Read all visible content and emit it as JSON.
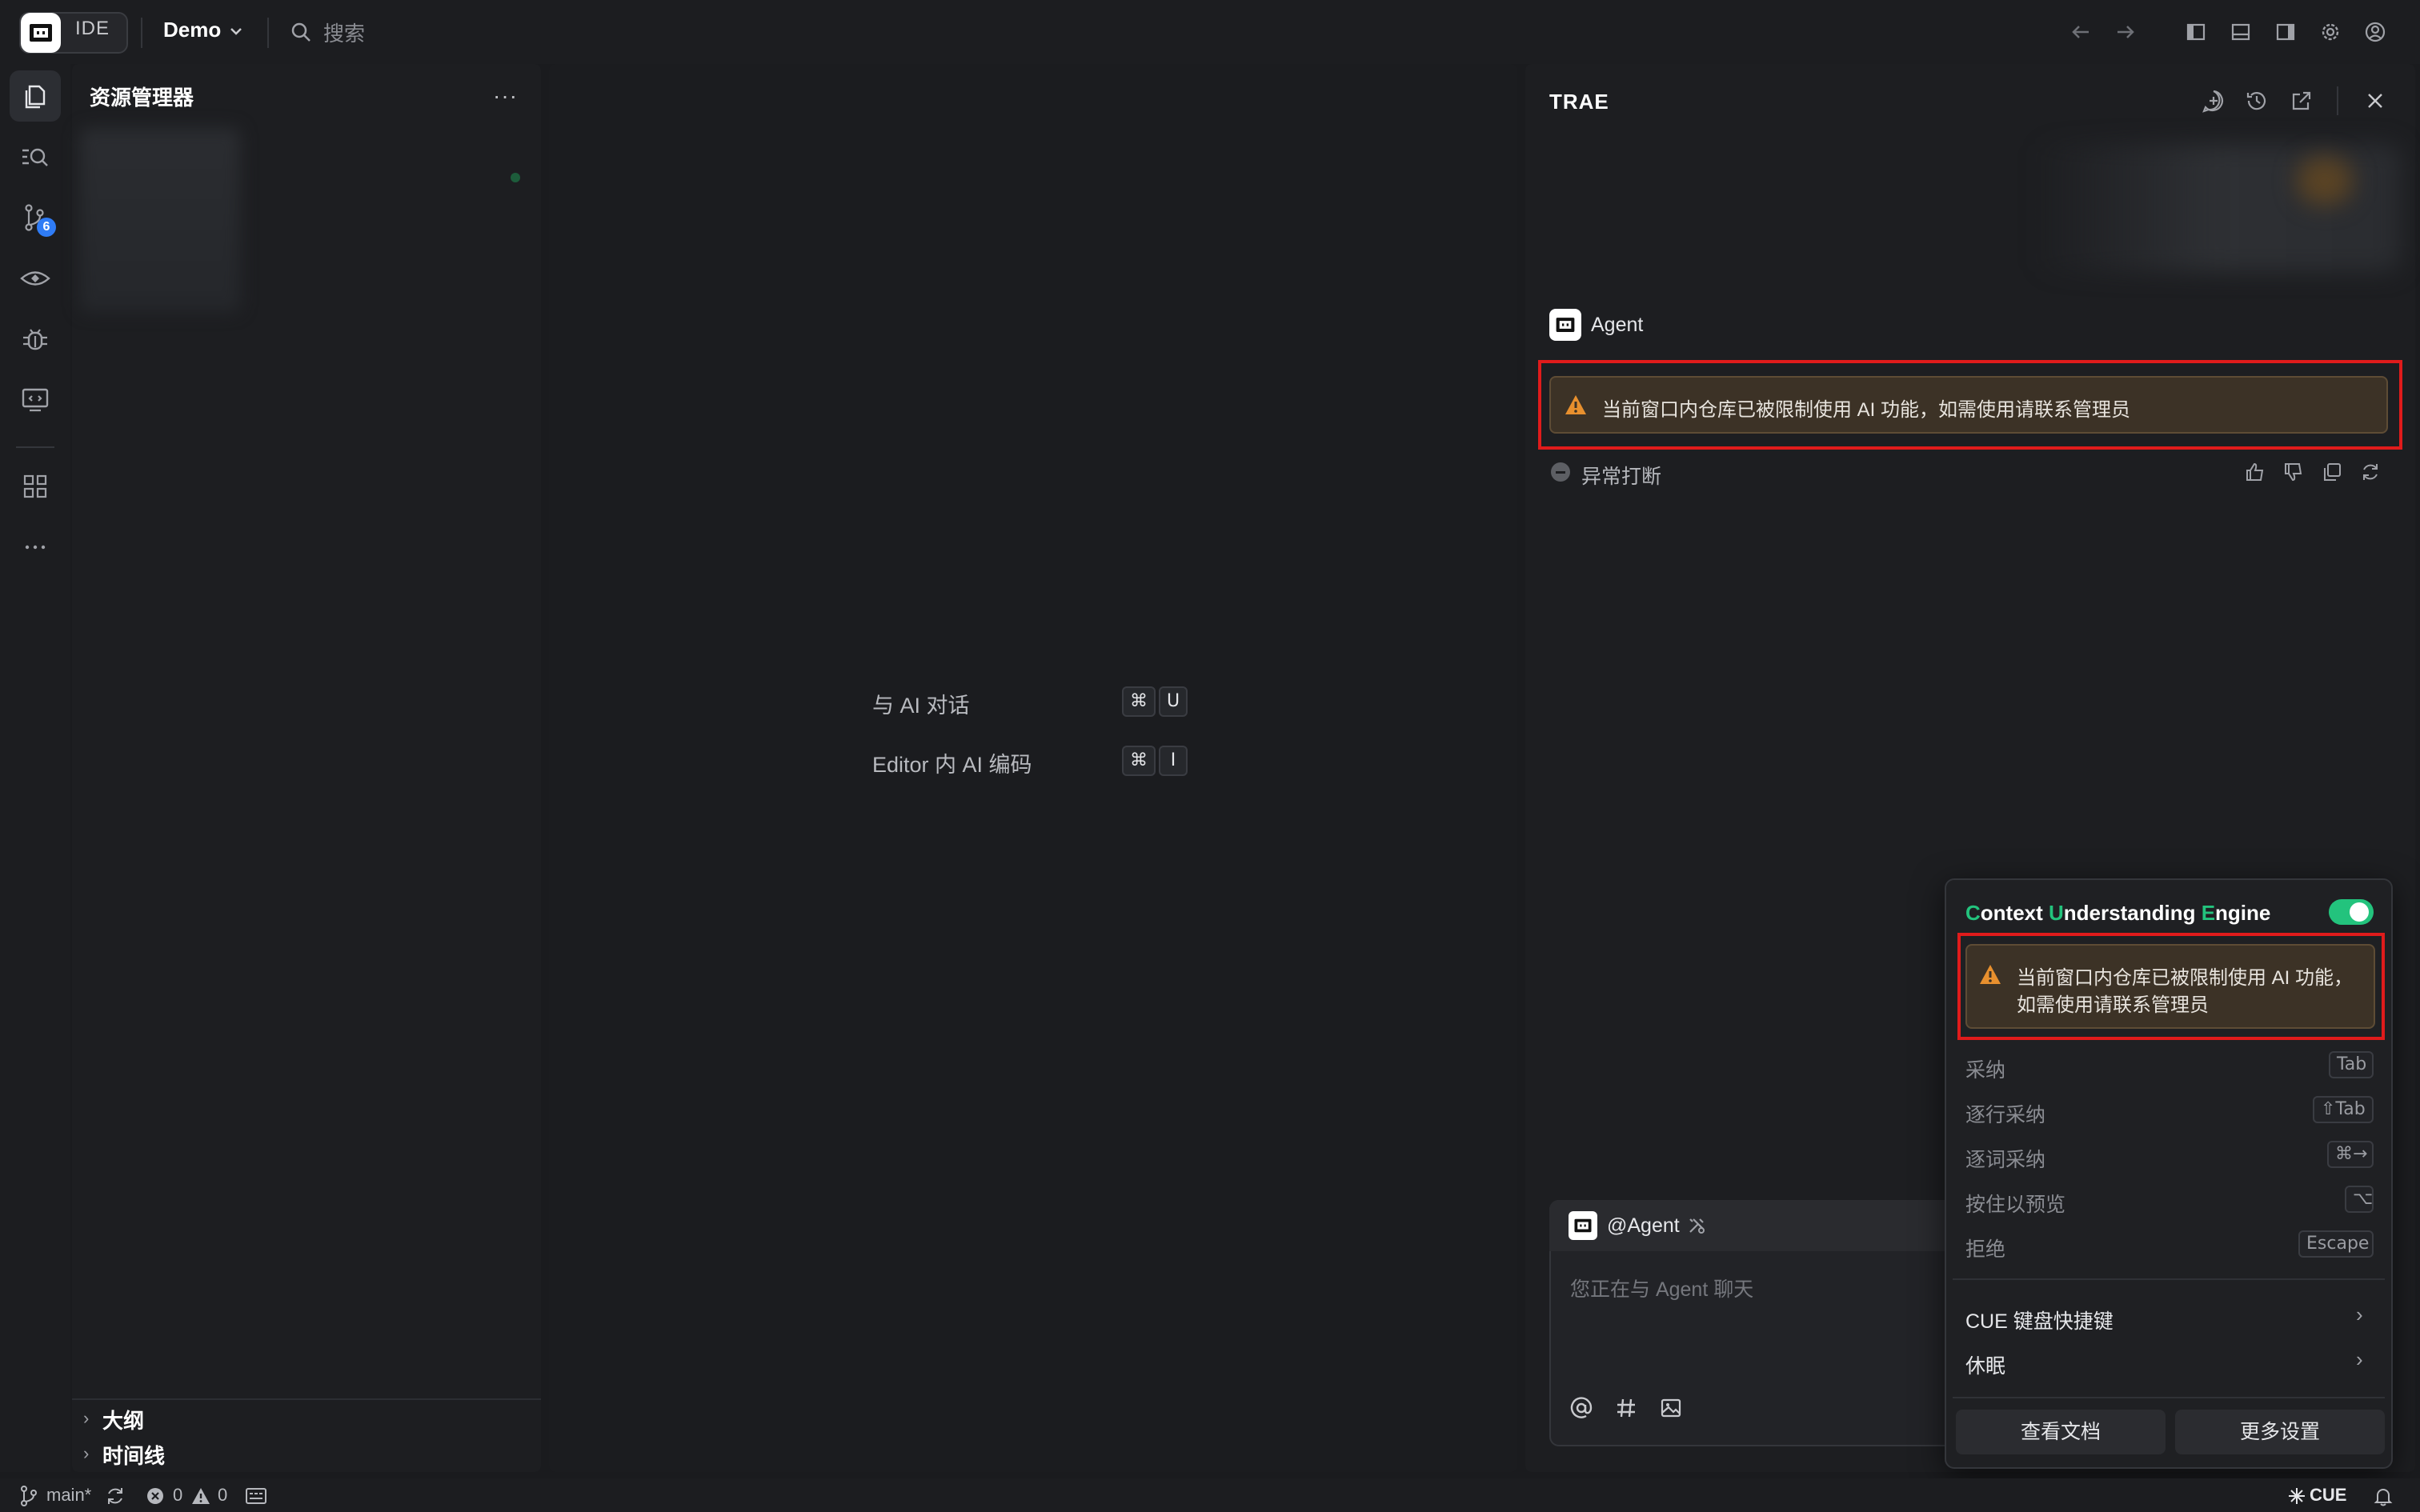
{
  "titlebar": {
    "app_name": "IDE",
    "project": "Demo",
    "search_label": "搜索"
  },
  "explorer": {
    "title": "资源管理器",
    "more": "···",
    "outline_label": "大纲",
    "timeline_label": "时间线"
  },
  "activity": {
    "scm_badge": "6"
  },
  "editor": {
    "hints": [
      {
        "label": "与 AI 对话",
        "keys": [
          "⌘",
          "U"
        ]
      },
      {
        "label": "Editor 内 AI 编码",
        "keys": [
          "⌘",
          "I"
        ]
      }
    ]
  },
  "chat": {
    "title": "TRAE",
    "agent_name": "Agent",
    "warning": "当前窗口内仓库已被限制使用 AI 功能，如需使用请联系管理员",
    "status": "异常打断",
    "input": {
      "agent_label": "@Agent",
      "placeholder": "您正在与 Agent 聊天"
    }
  },
  "cue": {
    "title_parts": [
      "C",
      "ontext ",
      "U",
      "nderstanding ",
      "E",
      "ngine"
    ],
    "toggle_on": true,
    "warning_line1": "当前窗口内仓库已被限制使用 AI 功能，",
    "warning_line2": "如需使用请联系管理员",
    "shortcuts": [
      {
        "label": "采纳",
        "key": "Tab"
      },
      {
        "label": "逐行采纳",
        "key": "⇧Tab"
      },
      {
        "label": "逐词采纳",
        "key": "⌘→"
      },
      {
        "label": "按住以预览",
        "key": "⌥"
      },
      {
        "label": "拒绝",
        "key": "Escape"
      }
    ],
    "menu": [
      {
        "label": "CUE 键盘快捷键"
      },
      {
        "label": "休眠"
      }
    ],
    "buttons": {
      "docs": "查看文档",
      "settings": "更多设置"
    }
  },
  "statusbar": {
    "branch": "main*",
    "errors": "0",
    "warnings": "0",
    "cue_label": "CUE"
  },
  "colors": {
    "accent_green": "#23c37d",
    "warning_orange": "#e8902e",
    "highlight_red": "#e01b1b",
    "badge_blue": "#2f7cf6"
  }
}
